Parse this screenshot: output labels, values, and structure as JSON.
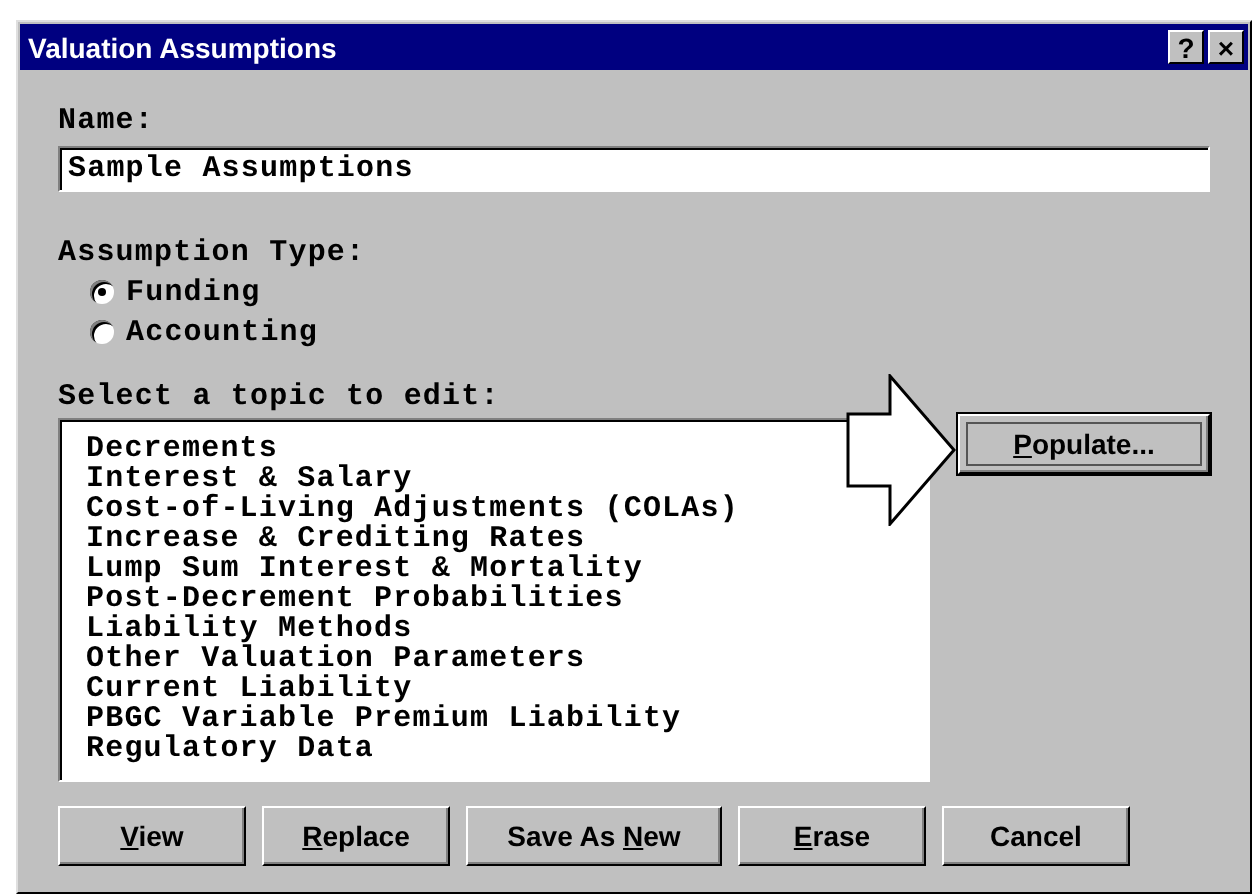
{
  "window": {
    "title": "Valuation Assumptions",
    "help_button": "?",
    "close_button": "×"
  },
  "name_field": {
    "label": "Name:",
    "value": "Sample Assumptions"
  },
  "assumption_type": {
    "label": "Assumption Type:",
    "options": [
      {
        "label": "Funding",
        "selected": true
      },
      {
        "label": "Accounting",
        "selected": false
      }
    ]
  },
  "topics": {
    "label": "Select a topic to edit:",
    "items": [
      "Decrements",
      "Interest & Salary",
      "Cost-of-Living Adjustments (COLAs)",
      "Increase & Crediting Rates",
      "Lump Sum Interest & Mortality",
      "Post-Decrement Probabilities",
      "Liability Methods",
      "Other Valuation Parameters",
      "Current Liability",
      "PBGC Variable Premium Liability",
      "Regulatory Data"
    ]
  },
  "populate_button": {
    "key": "P",
    "after": "opulate...",
    "focused": true
  },
  "buttons": [
    {
      "key": "V",
      "after": "iew"
    },
    {
      "key": "R",
      "after": "eplace"
    },
    {
      "before": "Save As ",
      "key": "N",
      "after": "ew"
    },
    {
      "key": "E",
      "after": "rase"
    },
    {
      "before": "Cancel"
    }
  ]
}
